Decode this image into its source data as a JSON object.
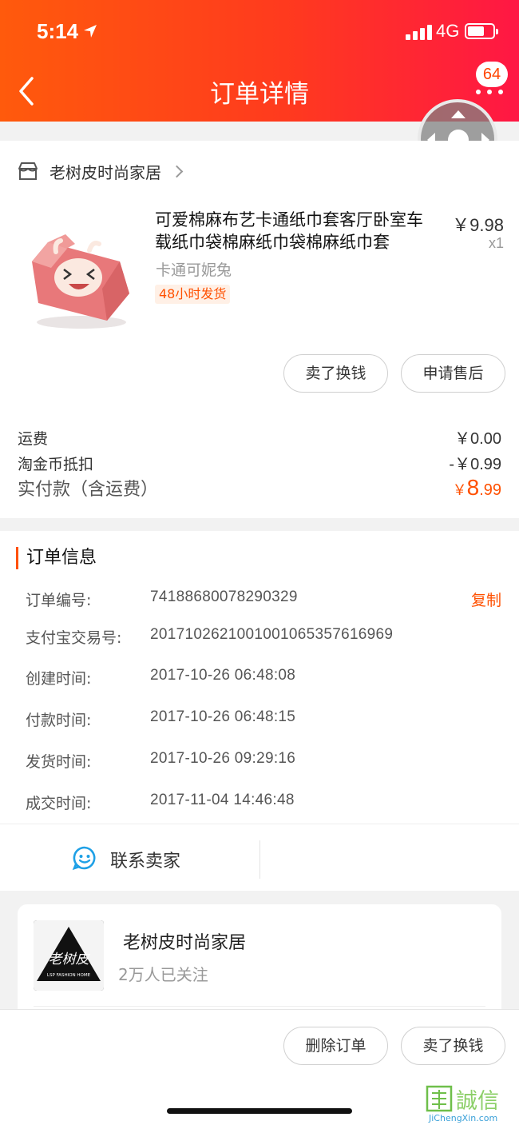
{
  "status_bar": {
    "time": "5:14",
    "network": "4G"
  },
  "header": {
    "title": "订单详情",
    "badge_count": "64"
  },
  "shop": {
    "name": "老树皮时尚家居"
  },
  "product": {
    "title": "可爱棉麻布艺卡通纸巾套客厅卧室车载纸巾袋棉麻纸巾袋棉麻纸巾套",
    "price": "￥9.98",
    "quantity": "x1",
    "sku": "卡通可妮兔",
    "ship_tag": "48小时发货",
    "actions": [
      "卖了换钱",
      "申请售后"
    ]
  },
  "fees": {
    "shipping_label": "运费",
    "shipping_value": "￥0.00",
    "coin_label": "淘金币抵扣",
    "coin_value": "-￥0.99",
    "total_label": "实付款（含运费）",
    "total_symbol": "￥",
    "total_int": "8",
    "total_dec": ".99"
  },
  "order_info": {
    "title": "订单信息",
    "copy_label": "复制",
    "rows": [
      {
        "label": "订单编号:",
        "value": "74188680078290329"
      },
      {
        "label": "支付宝交易号:",
        "value": "2017102621001001065357616969"
      },
      {
        "label": "创建时间:",
        "value": "2017-10-26 06:48:08"
      },
      {
        "label": "付款时间:",
        "value": "2017-10-26 06:48:15"
      },
      {
        "label": "发货时间:",
        "value": "2017-10-26 09:29:16"
      },
      {
        "label": "成交时间:",
        "value": "2017-11-04 14:46:48"
      }
    ]
  },
  "contact": {
    "label": "联系卖家"
  },
  "store_card": {
    "name": "老树皮时尚家居",
    "followers": "2万人已关注",
    "logo_text": "老树皮",
    "logo_sub": "LSP FASHION HOME"
  },
  "bottom_actions": [
    "删除订单",
    "卖了换钱"
  ],
  "watermark": {
    "text": "誠信",
    "sub": "JiChengXin.com"
  },
  "colors": {
    "accent": "#ff5000",
    "header_start": "#ff5a0c",
    "header_end": "#ff1744"
  }
}
